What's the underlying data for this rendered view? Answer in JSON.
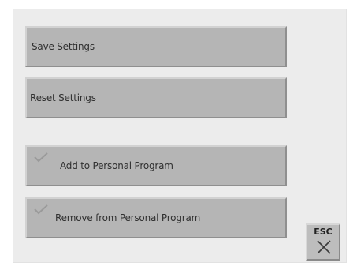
{
  "menu": {
    "save_label": "Save Settings",
    "reset_label": "Reset Settings",
    "add_label": "Add to Personal Program",
    "remove_label": "Remove from Personal Program"
  },
  "esc": {
    "label": "ESC"
  },
  "icons": {
    "add": "check-icon",
    "remove": "check-icon",
    "esc": "close-icon"
  }
}
